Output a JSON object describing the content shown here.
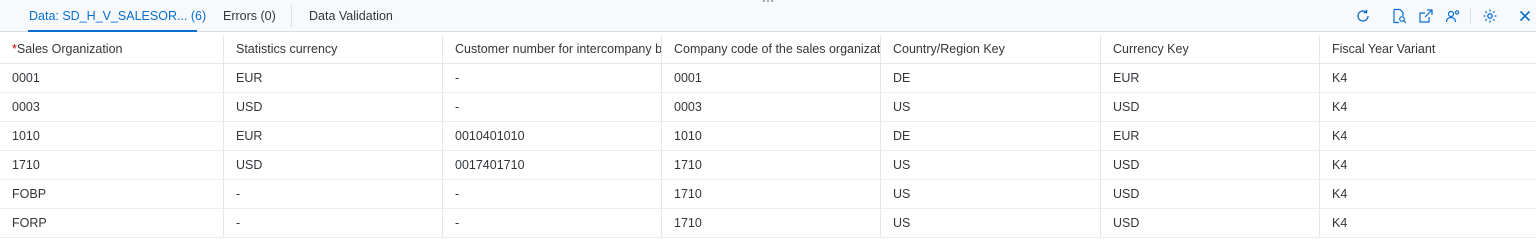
{
  "tabs": [
    {
      "label": "Data: SD_H_V_SALESOR... (6)",
      "active": true
    },
    {
      "label": "Errors (0)",
      "active": false
    },
    {
      "label": "Data Validation",
      "active": false
    }
  ],
  "toolbar": {
    "icons": [
      "refresh-icon",
      "document-search-icon",
      "export-icon",
      "user-settings-icon",
      "settings-icon",
      "close-icon"
    ]
  },
  "table": {
    "required_marker": "*",
    "columns": [
      "Sales Organization",
      "Statistics currency",
      "Customer number for intercompany bi",
      "Company code of the sales organizati",
      "Country/Region Key",
      "Currency Key",
      "Fiscal Year Variant"
    ],
    "rows": [
      [
        "0001",
        "EUR",
        "-",
        "0001",
        "DE",
        "EUR",
        "K4"
      ],
      [
        "0003",
        "USD",
        "-",
        "0003",
        "US",
        "USD",
        "K4"
      ],
      [
        "1010",
        "EUR",
        "0010401010",
        "1010",
        "DE",
        "EUR",
        "K4"
      ],
      [
        "1710",
        "USD",
        "0017401710",
        "1710",
        "US",
        "USD",
        "K4"
      ],
      [
        "FOBP",
        "-",
        "-",
        "1710",
        "US",
        "USD",
        "K4"
      ],
      [
        "FORP",
        "-",
        "-",
        "1710",
        "US",
        "USD",
        "K4"
      ]
    ]
  },
  "colors": {
    "accent": "#0a6ed1",
    "required": "#bb0000",
    "text": "#32363a",
    "icon": "#0a6ed1"
  }
}
